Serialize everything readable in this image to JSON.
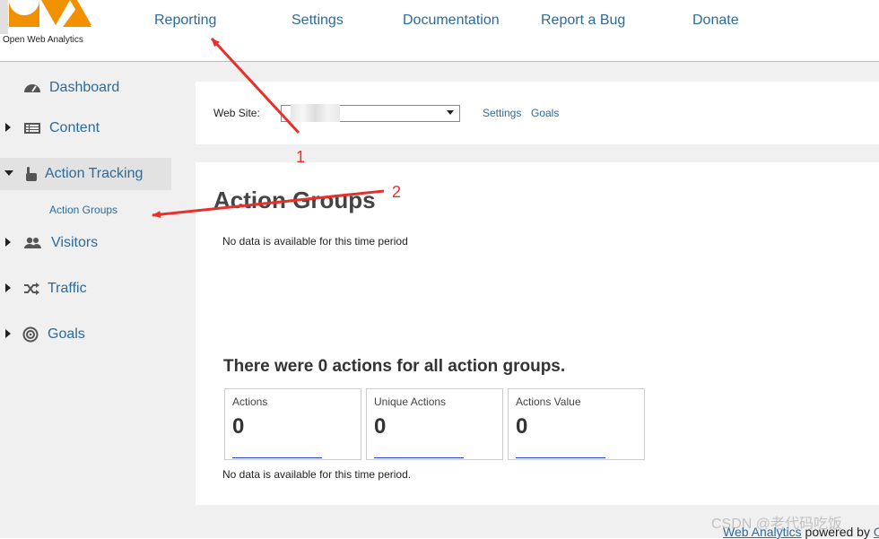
{
  "header": {
    "logo_text": "Open Web Analytics",
    "nav": [
      "Reporting",
      "Settings",
      "Documentation",
      "Report a Bug",
      "Donate"
    ]
  },
  "sidebar": {
    "items": [
      {
        "label": "Dashboard",
        "icon": "dashboard-icon"
      },
      {
        "label": "Content",
        "icon": "list-icon"
      },
      {
        "label": "Action Tracking",
        "icon": "hand-pointer-icon"
      },
      {
        "label": "Visitors",
        "icon": "users-icon"
      },
      {
        "label": "Traffic",
        "icon": "shuffle-icon"
      },
      {
        "label": "Goals",
        "icon": "target-icon"
      }
    ],
    "sub_item": "Action Groups"
  },
  "site_selector": {
    "label": "Web Site:",
    "links": [
      "Settings",
      "Goals"
    ]
  },
  "main": {
    "title": "Action Groups",
    "no_data_note": "No data is available for this time period",
    "summary": "There were 0 actions for all action groups.",
    "metrics": [
      {
        "label": "Actions",
        "value": "0"
      },
      {
        "label": "Unique Actions",
        "value": "0"
      },
      {
        "label": "Actions Value",
        "value": "0"
      }
    ],
    "no_data_note_2": "No data is available for this time period."
  },
  "footer": {
    "link": "Web Analytics",
    "text": " powered by ",
    "trailing_link": "O"
  },
  "annotations": {
    "labels": [
      "1",
      "2"
    ],
    "color": "#e8302a"
  },
  "watermark": "CSDN @老代码吃饭",
  "colors": {
    "link": "#2d6a9a",
    "logo_orange": "#f29100",
    "sidebar_bg": "#f0f0f0",
    "active_bg": "#e2e2e2"
  }
}
